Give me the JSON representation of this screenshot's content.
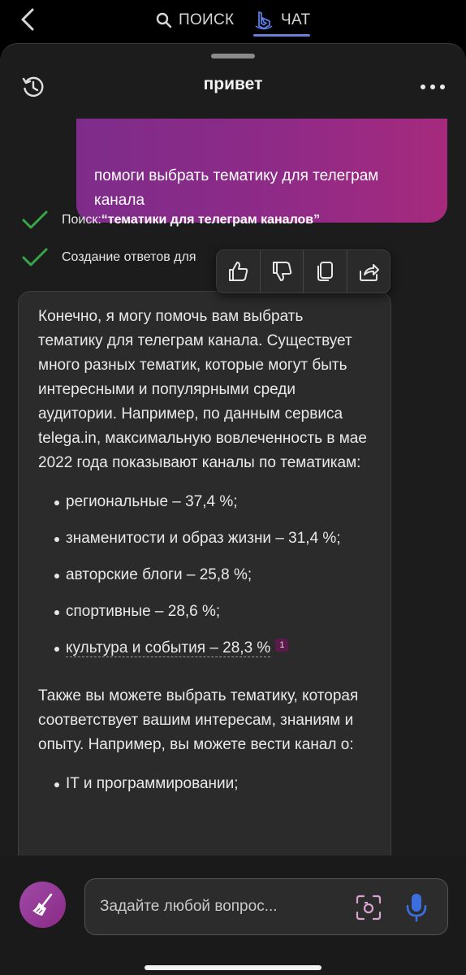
{
  "topnav": {
    "search_label": "ПОИСК",
    "chat_label": "ЧАТ",
    "accent": "#6b7fd6"
  },
  "sheet": {
    "title": "привет"
  },
  "user_message": {
    "text": "помоги выбрать тематику для телеграм канала",
    "colors": [
      "#7e2c8a",
      "#a62a7d"
    ]
  },
  "progress": [
    {
      "prefix": "Поиск: ",
      "query": "“тематики для телеграм каналов”"
    },
    {
      "prefix": "Создание ответов для",
      "query": ""
    }
  ],
  "bot_response": {
    "intro": "Конечно, я могу помочь вам выбрать тематику для телеграм канала. Существует много разных тематик, которые могут быть интересными и популярными среди аудитории. Например, по данным сервиса telega.in, максимальную вовлеченность в мае 2022 года показывают каналы по тематикам:",
    "topics": [
      "региональные – 37,4 %;",
      "знаменитости и образ жизни – 31,4 %;",
      "авторские блоги – 25,8 %;",
      "спортивные – 28,6 %;",
      "культура и события – 28,3 %"
    ],
    "citation": "1",
    "second_paragraph": "Также вы можете выбрать тематику, которая соответствует вашим интересам, знаниям и опыту. Например, вы можете вести канал о:",
    "interests": [
      "IT и программировании;"
    ]
  },
  "actions": {
    "icons": [
      "thumbs-up-icon",
      "thumbs-down-icon",
      "copy-icon",
      "share-icon"
    ]
  },
  "composer": {
    "placeholder": "Задайте любой вопрос...",
    "accent": "#9b3fa0",
    "mic_color": "#3b6fe0"
  }
}
